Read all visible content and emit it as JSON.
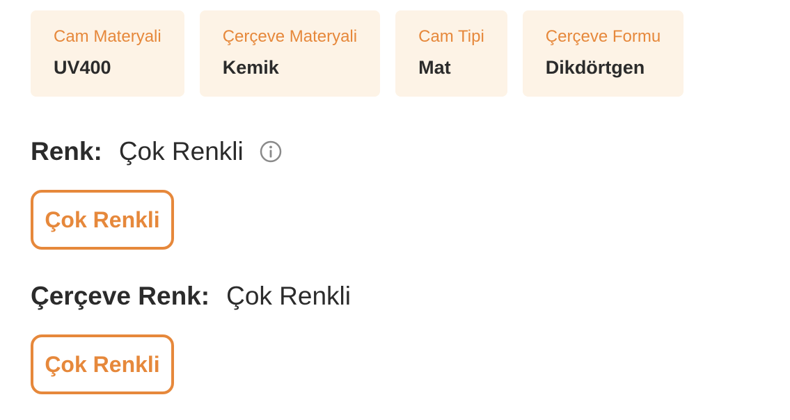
{
  "attributes": [
    {
      "label": "Cam Materyali",
      "value": "UV400"
    },
    {
      "label": "Çerçeve Materyali",
      "value": "Kemik"
    },
    {
      "label": "Cam Tipi",
      "value": "Mat"
    },
    {
      "label": "Çerçeve Formu",
      "value": "Dikdörtgen"
    }
  ],
  "color_section": {
    "label": "Renk:",
    "selected": "Çok Renkli",
    "info_icon": "info-circle-icon",
    "option": "Çok Renkli"
  },
  "frame_color_section": {
    "label": "Çerçeve Renk:",
    "selected": "Çok Renkli",
    "option": "Çok Renkli"
  },
  "colors": {
    "accent": "#e6883b",
    "card_bg": "#fdf3e6",
    "text": "#2b2b2b",
    "icon_gray": "#8a8a8a"
  }
}
